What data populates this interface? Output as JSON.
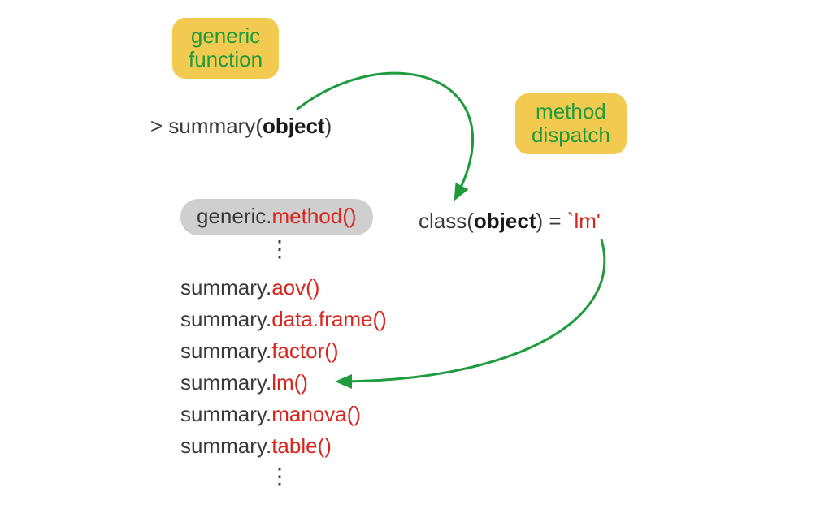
{
  "badges": {
    "generic": {
      "line1": "generic",
      "line2": "function"
    },
    "dispatch": {
      "line1": "method",
      "line2": "dispatch"
    }
  },
  "call_line": {
    "prompt": "> ",
    "fn": "summary",
    "open": "(",
    "arg": "object",
    "close": ")"
  },
  "generic_method_pill": {
    "left": "generic.",
    "right": "method()"
  },
  "class_line": {
    "fn": "class",
    "open": "(",
    "arg": "object",
    "close": ") = ",
    "val": "`lm'"
  },
  "methods": [
    {
      "prefix": "summary.",
      "suffix": "aov()"
    },
    {
      "prefix": "summary.",
      "suffix": "data.frame()"
    },
    {
      "prefix": "summary.",
      "suffix": "factor()"
    },
    {
      "prefix": "summary.",
      "suffix": "lm()"
    },
    {
      "prefix": "summary.",
      "suffix": "manova()"
    },
    {
      "prefix": "summary.",
      "suffix": "table()"
    }
  ],
  "dots": "⋮",
  "colors": {
    "green": "#1f9b3d",
    "badge": "#f2ca50",
    "red": "#d7261e",
    "grey": "#cfcfcf"
  }
}
